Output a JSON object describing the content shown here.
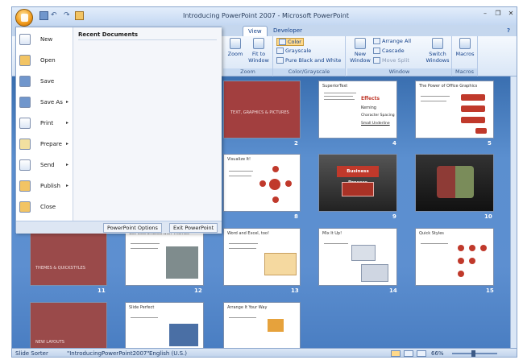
{
  "window": {
    "title": "Introducing PowerPoint 2007 - Microsoft PowerPoint",
    "minimize": "–",
    "restore": "❐",
    "close": "✕",
    "help": "?"
  },
  "tabs": [
    {
      "label": "View"
    },
    {
      "label": "Developer"
    }
  ],
  "ribbon": {
    "zoom_group": {
      "label": "Zoom",
      "zoom": "Zoom",
      "fit": "Fit to Window"
    },
    "color_group": {
      "label": "Color/Grayscale",
      "color": "Color",
      "grayscale": "Grayscale",
      "pure_bw": "Pure Black and White"
    },
    "window_group": {
      "label": "Window",
      "new_window": "New Window",
      "arrange_all": "Arrange All",
      "cascade": "Cascade",
      "move_split": "Move Split",
      "switch_windows": "Switch Windows"
    },
    "macros_group": {
      "label": "Macros",
      "macros": "Macros"
    }
  },
  "office_menu": {
    "items": [
      {
        "label": "New"
      },
      {
        "label": "Open"
      },
      {
        "label": "Save"
      },
      {
        "label": "Save As",
        "arrow": "▸"
      },
      {
        "label": "Print",
        "arrow": "▸"
      },
      {
        "label": "Prepare",
        "arrow": "▸"
      },
      {
        "label": "Send",
        "arrow": "▸"
      },
      {
        "label": "Publish",
        "arrow": "▸"
      },
      {
        "label": "Close"
      }
    ],
    "recent_title": "Recent Documents",
    "options_button": "PowerPoint Options",
    "exit_button": "Exit PowerPoint"
  },
  "slides": [
    {
      "num": "2",
      "title": "TEXT, GRAPHICS & PICTURES"
    },
    {
      "num": "4",
      "title": "SuperiorText",
      "lines": [
        "Effects",
        "Kerning",
        "Character Spacing",
        "Small Underline"
      ]
    },
    {
      "num": "5",
      "title": "The Power of Office Graphics"
    },
    {
      "num": "8",
      "title": "Visualize It!"
    },
    {
      "num": "9",
      "title": "Business Process"
    },
    {
      "num": "10",
      "title": ""
    },
    {
      "num": "11",
      "title": "THEMES & QUICKSTYLES"
    },
    {
      "num": "12",
      "title": "Get Coordinated with Themes"
    },
    {
      "num": "13",
      "title": "Word and Excel, too!"
    },
    {
      "num": "14",
      "title": "Mix It Up!"
    },
    {
      "num": "15",
      "title": "Quick Styles"
    },
    {
      "num": "",
      "title": "NEW LAYOUTS"
    },
    {
      "num": "",
      "title": "Slide Perfect"
    },
    {
      "num": "",
      "title": "Arrange It Your Way"
    }
  ],
  "status": {
    "view": "Slide Sorter",
    "doc": "\"IntroducingPowerPoint2007\"",
    "language": "English (U.S.)",
    "zoom": "66%"
  },
  "colors": {
    "accent": "#c5d7ee",
    "slide_red": "#a23f3f",
    "desktop": "#5b8fcf"
  }
}
